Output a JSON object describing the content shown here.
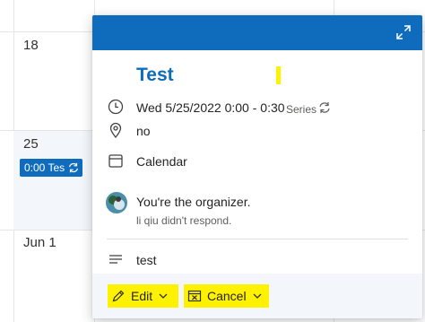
{
  "calendar": {
    "days": [
      "18",
      "25",
      "Jun 1"
    ],
    "event_chip_label": "0:00 Tes",
    "right_edge_fragment": "i"
  },
  "popup": {
    "title": "Test",
    "datetime": "Wed 5/25/2022 0:00 - 0:30",
    "series_label": "Series",
    "location": "no",
    "calendar_name": "Calendar",
    "organizer_text": "You're the organizer.",
    "response_text": "li qiu didn't respond.",
    "description": "test",
    "actions": {
      "edit_label": "Edit",
      "cancel_label": "Cancel"
    }
  },
  "colors": {
    "accent": "#0f6cbd",
    "highlight": "#fff200",
    "footer_bg": "#f3f7fb"
  },
  "icons": [
    "expand-icon",
    "clock-icon",
    "location-pin-icon",
    "calendar-icon",
    "description-lines-icon",
    "recurrence-icon",
    "pencil-icon",
    "cancel-calendar-icon",
    "chevron-down-icon"
  ]
}
